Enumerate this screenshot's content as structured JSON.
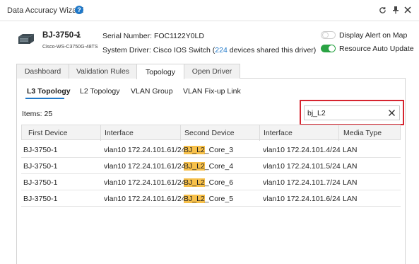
{
  "window": {
    "title": "Data Accuracy Wizard",
    "help_glyph": "?",
    "controls": {
      "refresh": "↻",
      "pin": "⊥",
      "close": "✕"
    }
  },
  "device": {
    "name": "BJ-3750-1",
    "model": "Cisco-WS-C3750G-48TS",
    "serial_label": "Serial Number:",
    "serial_value": "FOC1122Y0LD",
    "driver_label": "System Driver:",
    "driver_value": "Cisco IOS Switch",
    "shared_open": "(",
    "shared_count": "224",
    "shared_suffix": "devices shared this driver)"
  },
  "toggles": [
    {
      "label": "Display Alert on Map",
      "state": "off"
    },
    {
      "label": "Resource Auto Update",
      "state": "on"
    }
  ],
  "tabs": [
    {
      "label": "Dashboard",
      "active": false
    },
    {
      "label": "Validation Rules",
      "active": false
    },
    {
      "label": "Topology",
      "active": true
    },
    {
      "label": "Open Driver",
      "active": false
    }
  ],
  "subtabs": [
    {
      "label": "L3 Topology",
      "active": true
    },
    {
      "label": "L2 Topology",
      "active": false
    },
    {
      "label": "VLAN Group",
      "active": false
    },
    {
      "label": "VLAN Fix-up Link",
      "active": false
    }
  ],
  "items_count": "Items: 25",
  "search": {
    "value": "bj_L2"
  },
  "table": {
    "columns": [
      "First Device",
      "Interface",
      "Second Device",
      "Interface",
      "Media Type"
    ],
    "rows": [
      {
        "first_device": "BJ-3750-1",
        "interface1": "vlan10 172.24.101.61/24",
        "second_hl": "BJ_L2",
        "second_rest": "_Core_3",
        "interface2": "vlan10 172.24.101.4/24",
        "media": "LAN"
      },
      {
        "first_device": "BJ-3750-1",
        "interface1": "vlan10 172.24.101.61/24",
        "second_hl": "BJ_L2",
        "second_rest": "_Core_4",
        "interface2": "vlan10 172.24.101.5/24",
        "media": "LAN"
      },
      {
        "first_device": "BJ-3750-1",
        "interface1": "vlan10 172.24.101.61/24",
        "second_hl": "BJ_L2",
        "second_rest": "_Core_6",
        "interface2": "vlan10 172.24.101.7/24",
        "media": "LAN"
      },
      {
        "first_device": "BJ-3750-1",
        "interface1": "vlan10 172.24.101.61/24",
        "second_hl": "BJ_L2",
        "second_rest": "_Core_5",
        "interface2": "vlan10 172.24.101.6/24",
        "media": "LAN"
      }
    ]
  },
  "colors": {
    "accent": "#1f78c8",
    "toggle_on": "#2aa344",
    "highlight": "#f7c04a",
    "search_outline": "#d6242f"
  }
}
